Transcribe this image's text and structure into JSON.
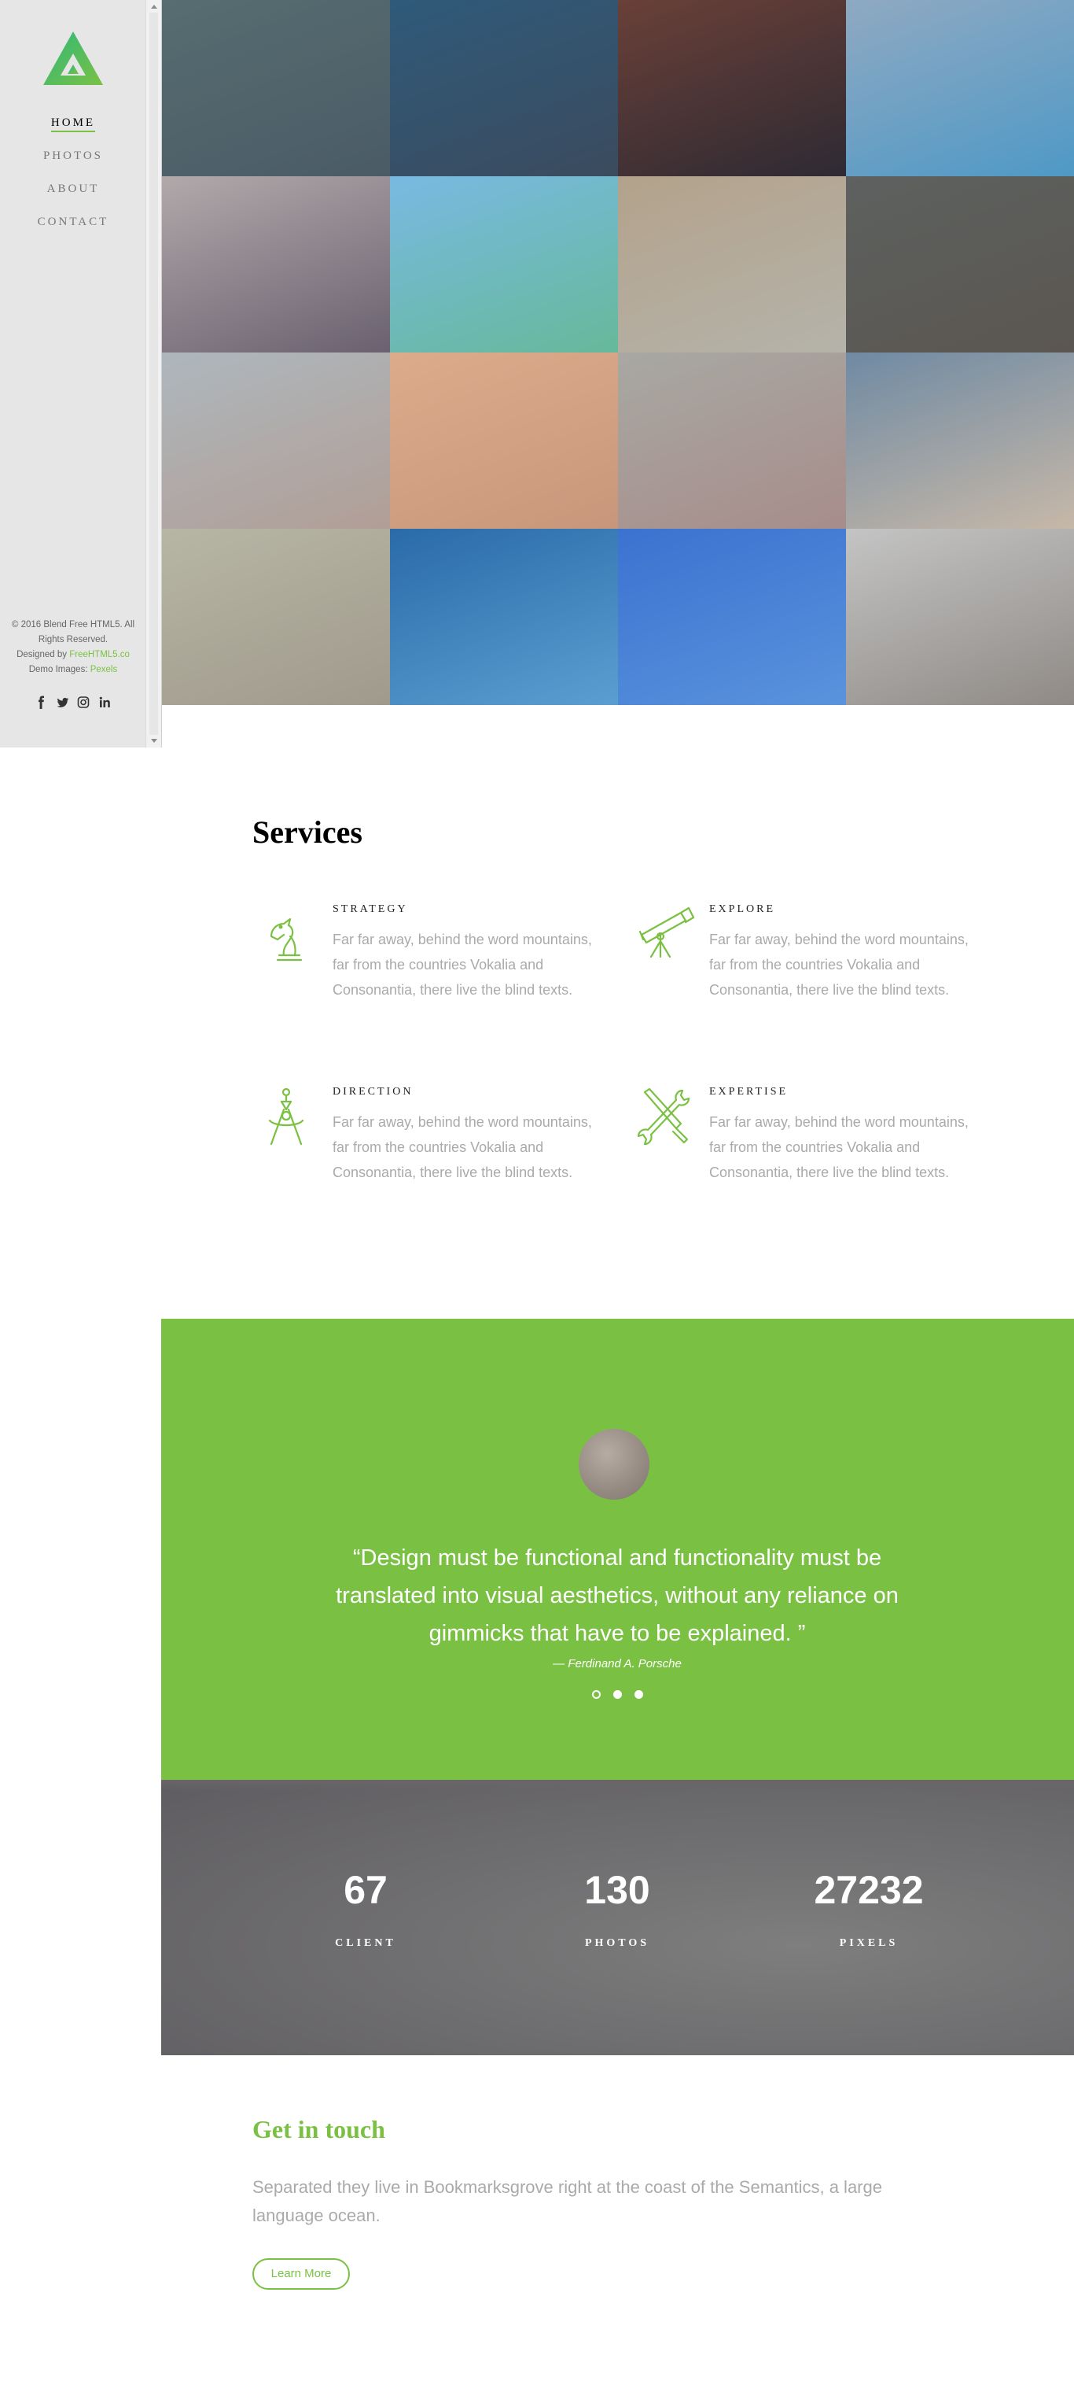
{
  "sidebar": {
    "nav": [
      {
        "label": "Home",
        "active": true
      },
      {
        "label": "Photos",
        "active": false
      },
      {
        "label": "About",
        "active": false
      },
      {
        "label": "Contact",
        "active": false
      }
    ],
    "footer": {
      "copyright": "© 2016 Blend Free HTML5. All Rights Reserved.",
      "designed_by_prefix": "Designed by",
      "designed_by_link": "FreeHTML5.co",
      "demo_images_prefix": "Demo Images:",
      "demo_images_link": "Pexels"
    },
    "social_icons": [
      "facebook-icon",
      "twitter-icon",
      "instagram-icon",
      "linkedin-icon"
    ]
  },
  "colors": {
    "accent": "#7ac143",
    "sidebar_bg": "#e6e6e6",
    "muted_text": "#aaaaaa"
  },
  "gallery": {
    "tiles": [
      {
        "from": "#566d71",
        "to": "#4b5b66"
      },
      {
        "from": "#2f5a7a",
        "to": "#3b4b5e"
      },
      {
        "from": "#6a4038",
        "to": "#2e2a33"
      },
      {
        "from": "#8fa9c2",
        "to": "#4f99c6"
      },
      {
        "from": "#b1a9aa",
        "to": "#6a6170"
      },
      {
        "from": "#79b9e2",
        "to": "#66b99a"
      },
      {
        "from": "#b3a28b",
        "to": "#b5b3aa"
      },
      {
        "from": "#5d615f",
        "to": "#5b5651"
      },
      {
        "from": "#aeb7bd",
        "to": "#b19e96"
      },
      {
        "from": "#dcab8c",
        "to": "#c8967a"
      },
      {
        "from": "#a8a8a2",
        "to": "#a78d8b"
      },
      {
        "from": "#6f8aa3",
        "to": "#c7b8a8"
      },
      {
        "from": "#b7b6a5",
        "to": "#a09a8c"
      },
      {
        "from": "#2a6aa9",
        "to": "#5a9fd1"
      },
      {
        "from": "#3b72d0",
        "to": "#5a93dd"
      },
      {
        "from": "#c4c4c4",
        "to": "#8f8a86"
      }
    ]
  },
  "services": {
    "title": "Services",
    "items": [
      {
        "name": "Strategy",
        "icon": "chess-knight-icon",
        "desc": "Far far away, behind the word mountains, far from the countries Vokalia and Consonantia, there live the blind texts."
      },
      {
        "name": "Explore",
        "icon": "telescope-icon",
        "desc": "Far far away, behind the word mountains, far from the countries Vokalia and Consonantia, there live the blind texts."
      },
      {
        "name": "Direction",
        "icon": "compass-drawing-icon",
        "desc": "Far far away, behind the word mountains, far from the countries Vokalia and Consonantia, there live the blind texts."
      },
      {
        "name": "Expertise",
        "icon": "tools-icon",
        "desc": "Far far away, behind the word mountains, far from the countries Vokalia and Consonantia, there live the blind texts."
      }
    ]
  },
  "testimonial": {
    "quote": "“Design must be functional and functionality must be translated into visual aesthetics, without any reliance on gimmicks that have to be explained. ”",
    "author": "— Ferdinand A. Porsche",
    "slides": 3,
    "active_slide": 1
  },
  "counters": [
    {
      "value": "67",
      "label": "CLIENT"
    },
    {
      "value": "130",
      "label": "PHOTOS"
    },
    {
      "value": "27232",
      "label": "PIXELS"
    }
  ],
  "contact": {
    "title": "Get in touch",
    "text": "Separated they live in Bookmarksgrove right at the coast of the Semantics, a large language ocean.",
    "button_label": "Learn More"
  }
}
